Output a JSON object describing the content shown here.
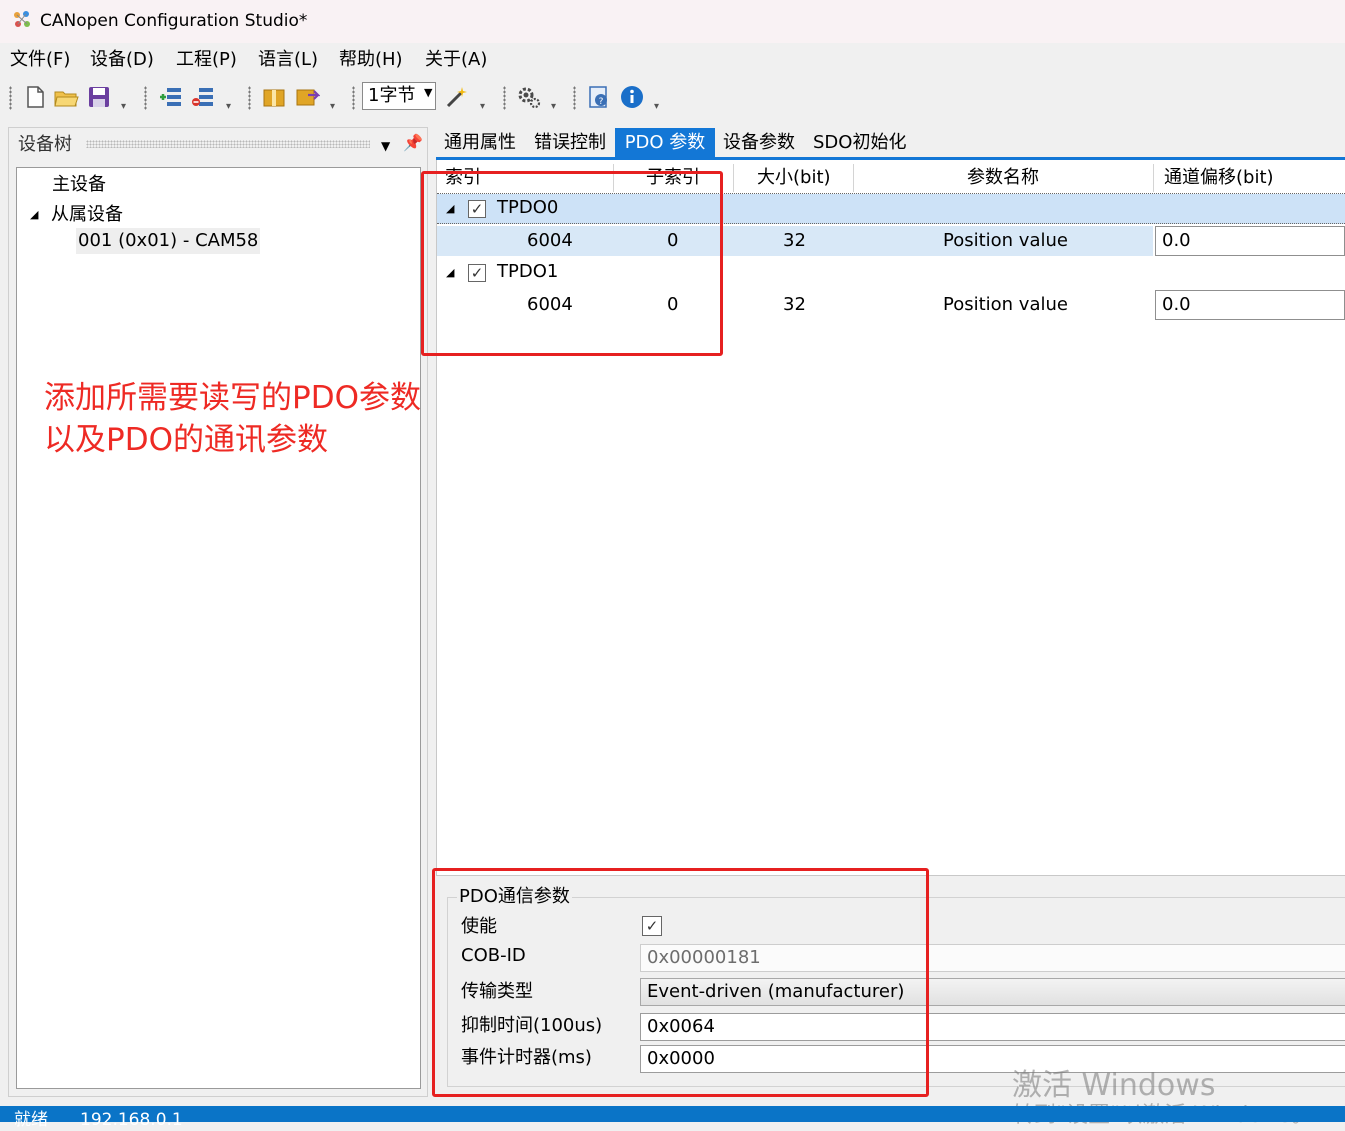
{
  "window": {
    "title": "CANopen Configuration Studio*"
  },
  "menu": [
    "文件(F)",
    "设备(D)",
    "工程(P)",
    "语言(L)",
    "帮助(H)",
    "关于(A)"
  ],
  "toolbar": {
    "bytes_select": "1字节"
  },
  "device_tree": {
    "title": "设备树",
    "master": "主设备",
    "slaves_group": "从属设备",
    "slave_node": "001 (0x01)  -  CAM58"
  },
  "annotation": {
    "line1": "添加所需要读写的PDO参数",
    "line2": "以及PDO的通讯参数",
    "color": "#ee2a24"
  },
  "tabs": [
    {
      "label": "通用属性",
      "active": false
    },
    {
      "label": "错误控制",
      "active": false
    },
    {
      "label": "PDO 参数",
      "active": true
    },
    {
      "label": "设备参数",
      "active": false
    },
    {
      "label": "SDO初始化",
      "active": false
    }
  ],
  "grid": {
    "columns": [
      "索引",
      "子索引",
      "大小(bit)",
      "参数名称",
      "通道偏移(bit)"
    ],
    "groups": [
      {
        "name": "TPDO0",
        "checked": true,
        "selected": true,
        "rows": [
          {
            "index": "6004",
            "subindex": "0",
            "size": "32",
            "name": "Position value",
            "offset": "0.0"
          }
        ]
      },
      {
        "name": "TPDO1",
        "checked": true,
        "selected": false,
        "rows": [
          {
            "index": "6004",
            "subindex": "0",
            "size": "32",
            "name": "Position value",
            "offset": "0.0"
          }
        ]
      }
    ]
  },
  "comm_params": {
    "title": "PDO通信参数",
    "enable_label": "使能",
    "enable_checked": true,
    "cobid_label": "COB-ID",
    "cobid_value": "0x00000181",
    "transmission_label": "传输类型",
    "transmission_value": "Event-driven (manufacturer)",
    "inhibit_label": "抑制时间(100us)",
    "inhibit_value": "0x0064",
    "event_timer_label": "事件计时器(ms)",
    "event_timer_value": "0x0000"
  },
  "watermark": {
    "line1": "激活 Windows",
    "line2": "转到\"设置\"以激活 Windows。"
  },
  "status": {
    "ready": "就绪",
    "ip": "192.168.0.1"
  },
  "colors": {
    "accent": "#1377d6",
    "selection": "#cde2f7",
    "statusbar": "#0a74c7",
    "annotation_box": "#e62020"
  }
}
